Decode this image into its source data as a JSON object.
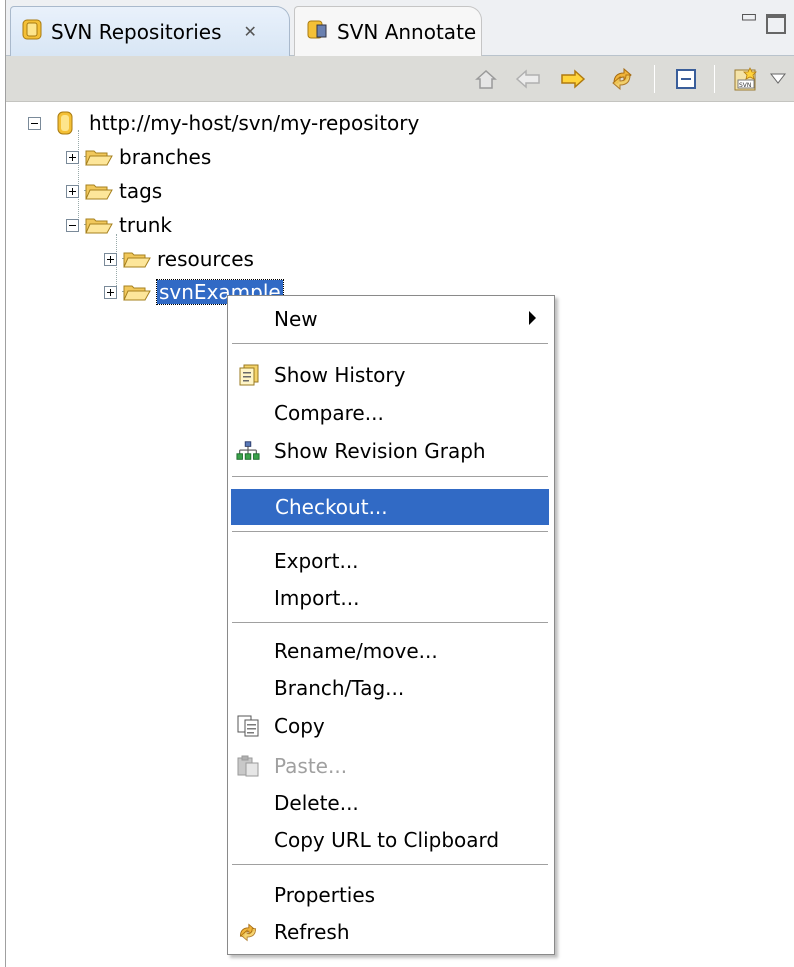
{
  "tabs": [
    {
      "label": "SVN Repositories",
      "icon": "repository-icon",
      "active": true
    },
    {
      "label": "SVN Annotate",
      "icon": "annotate-icon",
      "active": false
    }
  ],
  "toolbar": {
    "buttons": [
      "home-icon",
      "back-arrow-icon",
      "forward-arrow-icon",
      "refresh-icon",
      "collapse-all-icon",
      "new-repository-location-icon",
      "view-menu-icon"
    ]
  },
  "tree": {
    "root": "http://my-host/svn/my-repository",
    "items": [
      {
        "label": "branches"
      },
      {
        "label": "tags"
      },
      {
        "label": "trunk"
      },
      {
        "label": "resources"
      },
      {
        "label": "svnExample"
      }
    ]
  },
  "menu": {
    "new": "New",
    "show_history": "Show History",
    "compare": "Compare...",
    "show_revision_graph": "Show Revision Graph",
    "checkout": "Checkout...",
    "export": "Export...",
    "import": "Import...",
    "rename_move": "Rename/move...",
    "branch_tag": "Branch/Tag...",
    "copy": "Copy",
    "paste": "Paste...",
    "delete": "Delete...",
    "copy_url": "Copy URL to Clipboard",
    "properties": "Properties",
    "refresh": "Refresh"
  },
  "colors": {
    "selection": "#316ac5",
    "folder": "#f5c84c",
    "toolbar": "#dcdcd8"
  }
}
